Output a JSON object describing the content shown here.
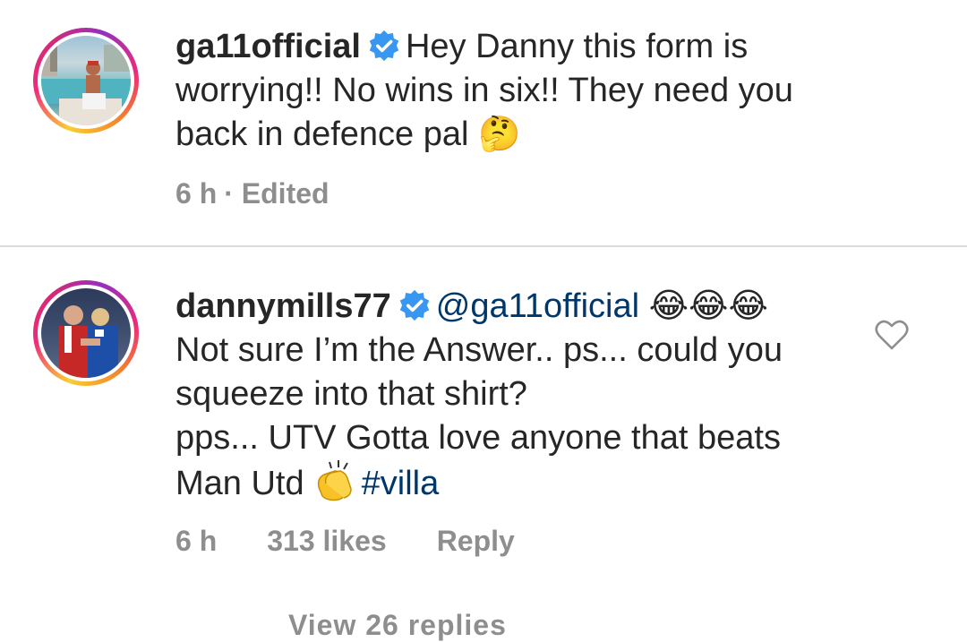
{
  "comments": [
    {
      "username": "ga11official",
      "verified": true,
      "text": "Hey Danny this form is worrying!! No wins in six!! They need you back in defence pal 🤔",
      "line1_rest": "Hey Danny this form is",
      "line2": "worrying!! No wins in six!! They need you",
      "line3": "back in defence pal 🤔",
      "time": "6 h",
      "edited": "· Edited",
      "avatar": "pool-photo-avatar"
    },
    {
      "username": "dannymills77",
      "verified": true,
      "mention": "@ga11official",
      "mention_emoji": "😂😂😂",
      "line2": "Not sure I’m the Answer.. ps... could you",
      "line3": "squeeze into that shirt?",
      "line4": "pps... UTV Gotta love anyone that beats",
      "line5_text": "Man Utd",
      "line5_emoji": "clapping-hands",
      "hashtag": "#villa",
      "time": "6 h",
      "likes": "313 likes",
      "reply": "Reply",
      "avatar": "football-photo-avatar"
    }
  ],
  "view_replies": "View 26 replies",
  "colors": {
    "link": "#00376b",
    "muted": "#8e8e8e",
    "verified": "#3897f0",
    "divider": "#dbdbdb"
  },
  "icons": {
    "verified": "verified-badge-icon",
    "like": "heart-outline-icon"
  }
}
